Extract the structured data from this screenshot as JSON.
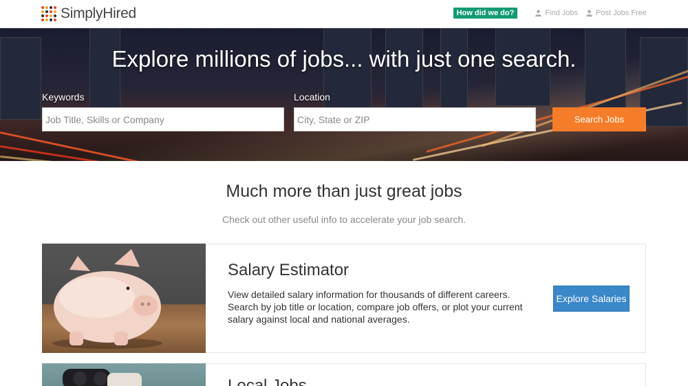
{
  "brand": {
    "name": "SimplyHired",
    "dot_colors": [
      "#e8452c",
      "#f5a623",
      "#2a2a2a",
      "#e8452c",
      "#f5a623",
      "#2a2a2a",
      "#e8452c",
      "#f5a623",
      "#2a2a2a",
      "#e8452c",
      "#f5a623",
      "#2a2a2a",
      "#e8452c",
      "#f5a623",
      "#2a2a2a",
      "#e8452c"
    ]
  },
  "nav": {
    "feedback_label": "How did we do?",
    "find_jobs_label": "Find Jobs",
    "post_jobs_label": "Post Jobs Free"
  },
  "hero": {
    "title": "Explore millions of jobs... with just one search.",
    "keywords_label": "Keywords",
    "keywords_placeholder": "Job Title, Skills or Company",
    "keywords_value": "",
    "location_label": "Location",
    "location_placeholder": "City, State or ZIP",
    "location_value": "",
    "search_button": "Search Jobs"
  },
  "section": {
    "title": "Much more than just great jobs",
    "subtitle": "Check out other useful info to accelerate your job search."
  },
  "cards": [
    {
      "title": "Salary Estimator",
      "description": "View detailed salary information for thousands of different careers. Search by job title or location, compare job offers, or plot your current salary against local and national averages.",
      "button": "Explore Salaries",
      "image_icon": "piggy-bank"
    },
    {
      "title": "Local Jobs",
      "image_icon": "binoculars"
    }
  ],
  "colors": {
    "accent_orange": "#f57d29",
    "accent_blue": "#3a87c9",
    "feedback_green": "#129b73"
  }
}
